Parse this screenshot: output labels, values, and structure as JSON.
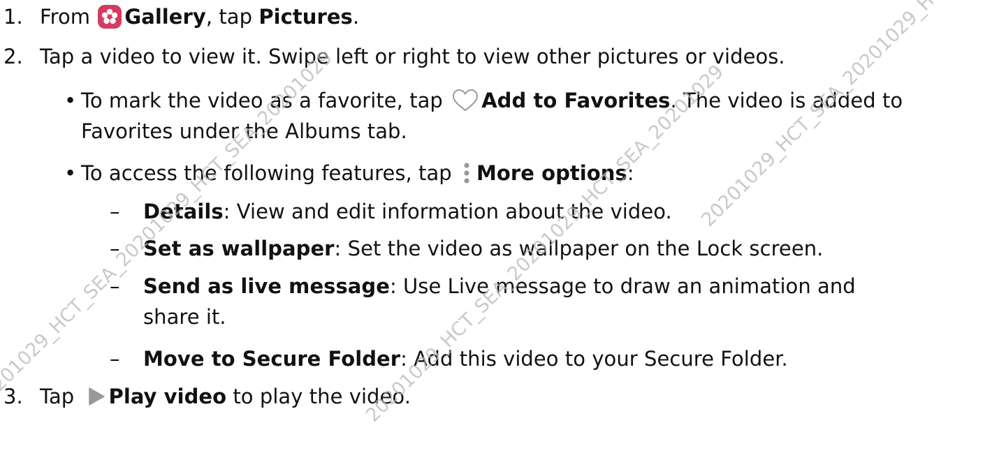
{
  "steps": {
    "step1": {
      "num": "1.",
      "prefix": "From",
      "gallery": "Gallery",
      "mid": ", tap ",
      "pictures": "Pictures",
      "end": "."
    },
    "step2": {
      "num": "2.",
      "text": "Tap a video to view it. Swipe left or right to view other pictures or videos."
    },
    "bullet1": {
      "prefix": "To mark the video as a favorite, tap",
      "bold": "Add to Favorites",
      "suffix": ". The video is added to",
      "line2": "Favorites under the Albums tab."
    },
    "bullet2": {
      "prefix": "To access the following features, tap",
      "bold": "More options",
      "suffix": ":"
    },
    "sub": [
      {
        "bold": "Details",
        "text": ": View and edit information about the video."
      },
      {
        "bold": "Set as wallpaper",
        "text": ": Set the video as wallpaper on the Lock screen."
      },
      {
        "bold": "Send as live message",
        "text": ": Use Live message to draw an animation and",
        "line2": "share it."
      },
      {
        "bold": "Move to Secure Folder",
        "text": ": Add this video to your Secure Folder."
      }
    ],
    "step3": {
      "num": "3.",
      "prefix": "Tap",
      "bold": "Play video",
      "suffix": " to play the video."
    }
  },
  "watermark_text": "20201029_HCT_SEA_20201029_HCT_SEA_20201029",
  "colors": {
    "gallery_icon_bg": "#d63a5e",
    "text": "#111111",
    "icon_gray": "#999999",
    "watermark": "#b8b8b8"
  },
  "icons": {
    "gallery": "gallery-flower-icon",
    "heart": "heart-outline-icon",
    "more": "more-options-vertical-dots-icon",
    "play": "play-triangle-icon"
  }
}
